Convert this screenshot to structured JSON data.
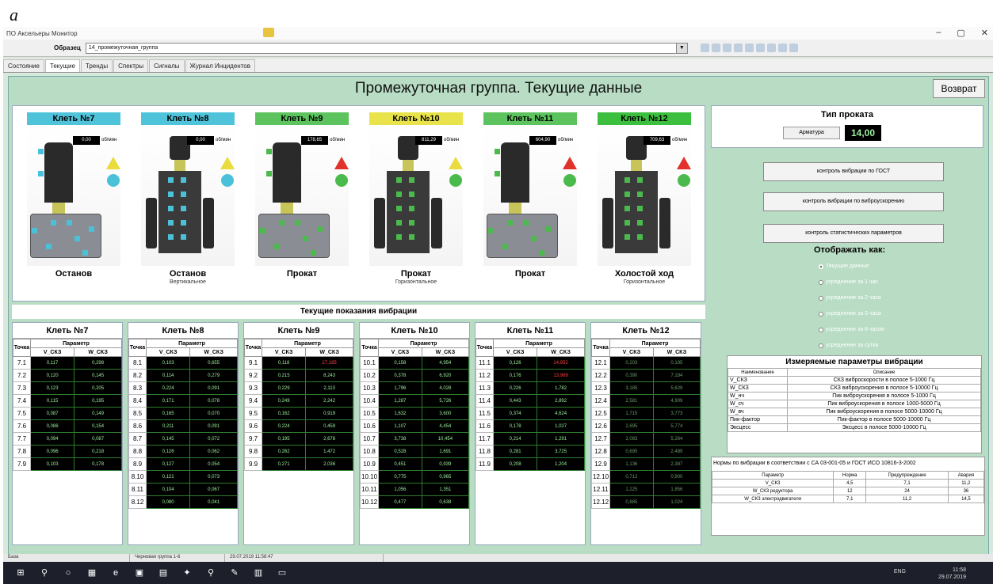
{
  "figure_label": "a",
  "app_title": "ПО Аксельеры Монитор",
  "window_controls": [
    "–",
    "▢",
    "✕"
  ],
  "sample_label": "Образец",
  "sample_value": "14_промежуточная_группа",
  "tabs": [
    "Состояние",
    "Текущие",
    "Тренды",
    "Спектры",
    "Сигналы",
    "Журнал Инцидентов"
  ],
  "main_title": "Промежуточная группа. Текущие данные",
  "back_label": "Возврат",
  "rpm_unit": "об/мин",
  "stands": [
    {
      "name": "Клеть №7",
      "head_color": "#4fc3da",
      "rpm": "0,00",
      "status": "Останов",
      "sub": "",
      "tri_color": "yellow",
      "circ_color": "cyan"
    },
    {
      "name": "Клеть №8",
      "head_color": "#4fc3da",
      "rpm": "0,00",
      "status": "Останов",
      "sub": "Вертикальное",
      "tri_color": "yellow",
      "circ_color": "cyan"
    },
    {
      "name": "Клеть №9",
      "head_color": "#5cc35e",
      "rpm": "178,65",
      "status": "Прокат",
      "sub": "",
      "tri_color": "red",
      "circ_color": "green"
    },
    {
      "name": "Клеть №10",
      "head_color": "#e8e34a",
      "rpm": "811,29",
      "status": "Прокат",
      "sub": "Горизонтальное",
      "tri_color": "yellow",
      "circ_color": "green"
    },
    {
      "name": "Клеть №11",
      "head_color": "#5cc35e",
      "rpm": "604,90",
      "status": "Прокат",
      "sub": "",
      "tri_color": "red",
      "circ_color": "green"
    },
    {
      "name": "Клеть №12",
      "head_color": "#3cbf3e",
      "rpm": "709,63",
      "status": "Холостой ход",
      "sub": "Горизонтальное",
      "tri_color": "red",
      "circ_color": "green"
    }
  ],
  "vib_title": "Текущие показания вибрации",
  "vib_cols": {
    "point": "Точка",
    "param": "Параметр",
    "v": "V_СКЗ",
    "w": "W_СКЗ"
  },
  "vib_tables": [
    {
      "name": "Клеть №7",
      "rows": [
        [
          "7.1",
          "0,117",
          "0,298"
        ],
        [
          "7.2",
          "0,120",
          "0,145"
        ],
        [
          "7.3",
          "0,123",
          "0,205"
        ],
        [
          "7.4",
          "0,115",
          "0,195"
        ],
        [
          "7.5",
          "0,087",
          "0,149"
        ],
        [
          "7.6",
          "0,086",
          "0,154"
        ],
        [
          "7.7",
          "0,094",
          "0,087"
        ],
        [
          "7.8",
          "0,096",
          "0,218"
        ],
        [
          "7.9",
          "0,103",
          "0,178"
        ]
      ]
    },
    {
      "name": "Клеть №8",
      "rows": [
        [
          "8.1",
          "0,103",
          "0,655"
        ],
        [
          "8.2",
          "0,114",
          "0,279"
        ],
        [
          "8.3",
          "0,224",
          "0,091"
        ],
        [
          "8.4",
          "0,171",
          "0,078"
        ],
        [
          "8.5",
          "0,165",
          "0,070"
        ],
        [
          "8.6",
          "0,211",
          "0,091"
        ],
        [
          "8.7",
          "0,145",
          "0,072"
        ],
        [
          "8.8",
          "0,126",
          "0,062"
        ],
        [
          "8.9",
          "0,127",
          "0,054"
        ],
        [
          "8.10",
          "0,121",
          "0,073"
        ],
        [
          "8.11",
          "0,104",
          "0,067"
        ],
        [
          "8.12",
          "0,080",
          "0,041"
        ]
      ]
    },
    {
      "name": "Клеть №9",
      "rows": [
        [
          "9.1",
          "0,118",
          "27,185"
        ],
        [
          "9.2",
          "0,215",
          "8,243"
        ],
        [
          "9.3",
          "0,229",
          "2,113"
        ],
        [
          "9.4",
          "0,249",
          "2,242"
        ],
        [
          "9.5",
          "0,162",
          "0,919"
        ],
        [
          "9.6",
          "0,224",
          "0,459"
        ],
        [
          "9.7",
          "0,195",
          "2,678"
        ],
        [
          "9.8",
          "0,262",
          "1,472"
        ],
        [
          "9.9",
          "0,271",
          "2,036"
        ]
      ]
    },
    {
      "name": "Клеть №10",
      "rows": [
        [
          "10.1",
          "0,158",
          "4,954"
        ],
        [
          "10.2",
          "0,378",
          "6,920"
        ],
        [
          "10.3",
          "1,796",
          "4,028"
        ],
        [
          "10.4",
          "1,287",
          "5,726"
        ],
        [
          "10.5",
          "1,632",
          "3,600"
        ],
        [
          "10.6",
          "1,107",
          "4,454"
        ],
        [
          "10.7",
          "3,738",
          "10,454"
        ],
        [
          "10.8",
          "0,528",
          "1,691"
        ],
        [
          "10.9",
          "0,451",
          "0,939"
        ],
        [
          "10.10",
          "0,775",
          "0,965"
        ],
        [
          "10.11",
          "1,056",
          "1,351"
        ],
        [
          "10.12",
          "0,477",
          "0,638"
        ]
      ]
    },
    {
      "name": "Клеть №11",
      "rows": [
        [
          "11.1",
          "0,126",
          "14,952"
        ],
        [
          "11.2",
          "0,176",
          "13,969"
        ],
        [
          "11.3",
          "0,226",
          "1,782"
        ],
        [
          "11.4",
          "0,443",
          "2,892"
        ],
        [
          "11.5",
          "0,374",
          "4,624"
        ],
        [
          "11.6",
          "0,178",
          "1,027"
        ],
        [
          "11.7",
          "0,214",
          "1,291"
        ],
        [
          "11.8",
          "0,281",
          "3,725"
        ],
        [
          "11.9",
          "0,208",
          "1,204"
        ]
      ]
    },
    {
      "name": "Клеть №12",
      "rows": [
        [
          "12.1",
          "0,203",
          "0,195"
        ],
        [
          "12.2",
          "0,390",
          "7,184"
        ],
        [
          "12.3",
          "3,185",
          "5,629"
        ],
        [
          "12.4",
          "2,581",
          "4,909"
        ],
        [
          "12.5",
          "1,715",
          "3,773"
        ],
        [
          "12.6",
          "2,695",
          "5,774"
        ],
        [
          "12.7",
          "2,083",
          "5,264"
        ],
        [
          "12.8",
          "0,695",
          "2,489"
        ],
        [
          "12.9",
          "1,136",
          "2,387"
        ],
        [
          "12.10",
          "0,712",
          "0,900"
        ],
        [
          "12.11",
          "1,225",
          "1,856"
        ],
        [
          "12.12",
          "0,885",
          "1,024"
        ]
      ]
    }
  ],
  "rolling_type_title": "Тип проката",
  "rolling_type_label": "Арматура",
  "rolling_type_value": "14,00",
  "control_buttons": [
    "контроль вибрации по ГОСТ",
    "контроль вибрации по виброускорению",
    "контроль статистических параметров"
  ],
  "display_title": "Отображать как:",
  "display_options": [
    "Текущие данные",
    "усреднение за 1 час",
    "усреднение за 2 часа",
    "усреднение за 3 часа",
    "усреднение за 8 часов",
    "усреднение за сутки"
  ],
  "measured_title": "Измеряемые параметры вибрации",
  "measured_cols": [
    "Наименование",
    "Описание"
  ],
  "measured_rows": [
    [
      "V_СКЗ",
      "СКЗ виброскорости в полосе 5-1000 Гц"
    ],
    [
      "W_СКЗ",
      "СКЗ виброускорения в полосе 5-10000 Гц"
    ],
    [
      "W_нч",
      "Пик виброускорения в полосе 5-1000 Гц"
    ],
    [
      "W_сч",
      "Пик виброускорения в полосе 1000-5000 Гц"
    ],
    [
      "W_вч",
      "Пик виброускорения в полосе 5000-10000 Гц"
    ],
    [
      "Пик-фактор",
      "Пик-фактор в полосе 5000-10000 Гц"
    ],
    [
      "Эксцесс",
      "Эксцесс в полосе 5000-10000 Гц"
    ]
  ],
  "norms_title": "Нормы по вибрации в соответствии с  СА 03-001-05 и ГОСТ ИСО 10816-3-2002",
  "norms_cols": [
    "Параметр",
    "Норма",
    "Предупреждение",
    "Авария"
  ],
  "norms_rows": [
    [
      "V_СКЗ",
      "4,5",
      "7,1",
      "11,2"
    ],
    [
      "W_СКЗ редуктора",
      "12",
      "24",
      "36"
    ],
    [
      "W_СКЗ электродвигателя",
      "7,1",
      "11,2",
      "14,5"
    ]
  ],
  "status_bar": [
    "База",
    "Черновая группа 1-6",
    "29.07.2019 11:58:47"
  ],
  "tray": {
    "lang": "ENG",
    "time": "11:58",
    "date": "29.07.2019"
  }
}
